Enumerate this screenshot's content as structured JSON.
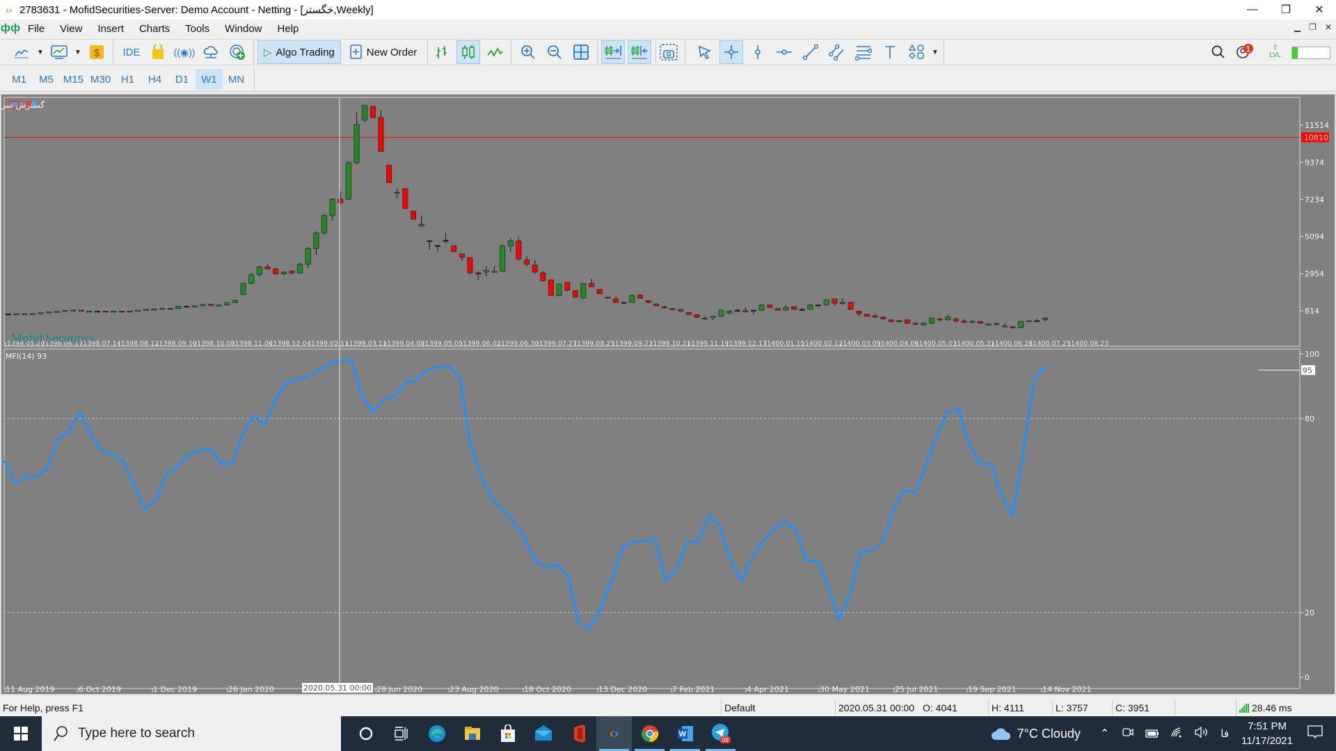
{
  "window": {
    "title": "2783631 - MofidSecurities-Server: Demo Account - Netting - [خگستر,Weekly]",
    "controls": [
      "minimize",
      "restore",
      "close"
    ]
  },
  "menu": {
    "items": [
      "File",
      "View",
      "Insert",
      "Charts",
      "Tools",
      "Window",
      "Help"
    ]
  },
  "toolbar": {
    "ide_label": "IDE",
    "algo_trading_label": "Algo Trading",
    "new_order_label": "New Order",
    "notification_count": "1",
    "level_label": "LVL"
  },
  "timeframes": {
    "items": [
      "M1",
      "M5",
      "M15",
      "M30",
      "H1",
      "H4",
      "D1",
      "W1",
      "MN"
    ],
    "active": "W1"
  },
  "chart": {
    "symbol_header": "گسترش سرمایه گذاری ایران خودرو  2430 2609 2368 2609  :Weekly ,خگستر",
    "watermark": "Mofid Securities",
    "indicator_label": "MFI(14) 93",
    "current_price_label": "10810",
    "mfi_current_label": "95",
    "crosshair_time_label": "2020.05.31 00:00"
  },
  "chart_data": [
    {
      "type": "candlestick",
      "title": "خگستر, Weekly",
      "ylim": [
        0,
        12500
      ],
      "yticks": [
        814,
        2954,
        5094,
        7234,
        9374,
        11514
      ],
      "current_price": 10810,
      "candles": [
        [
          640,
          660,
          620,
          640
        ],
        [
          640,
          660,
          620,
          645
        ],
        [
          645,
          660,
          625,
          650
        ],
        [
          650,
          670,
          630,
          655
        ],
        [
          655,
          720,
          640,
          700
        ],
        [
          700,
          760,
          690,
          750
        ],
        [
          750,
          800,
          720,
          780
        ],
        [
          780,
          860,
          760,
          830
        ],
        [
          830,
          900,
          790,
          860
        ],
        [
          860,
          870,
          770,
          790
        ],
        [
          790,
          820,
          760,
          800
        ],
        [
          800,
          820,
          780,
          800
        ],
        [
          800,
          820,
          770,
          790
        ],
        [
          790,
          810,
          770,
          800
        ],
        [
          800,
          810,
          760,
          780
        ],
        [
          780,
          820,
          770,
          800
        ],
        [
          800,
          870,
          780,
          850
        ],
        [
          850,
          920,
          830,
          900
        ],
        [
          900,
          950,
          880,
          920
        ],
        [
          920,
          980,
          900,
          960
        ],
        [
          960,
          970,
          900,
          950
        ],
        [
          950,
          1100,
          940,
          1080
        ],
        [
          1080,
          1120,
          1030,
          1080
        ],
        [
          1080,
          1130,
          1050,
          1100
        ],
        [
          1100,
          1200,
          1080,
          1190
        ],
        [
          1190,
          1200,
          1100,
          1130
        ],
        [
          1130,
          1170,
          1110,
          1150
        ],
        [
          1150,
          1300,
          1130,
          1290
        ],
        [
          1290,
          1450,
          1270,
          1420
        ],
        [
          1750,
          2450,
          1730,
          2400
        ],
        [
          2400,
          3000,
          2350,
          2900
        ],
        [
          2900,
          3400,
          2800,
          3350
        ],
        [
          3350,
          3500,
          3200,
          3230
        ],
        [
          3230,
          3300,
          2900,
          2950
        ],
        [
          2950,
          3100,
          2850,
          3050
        ],
        [
          3100,
          3150,
          2900,
          3000
        ],
        [
          3000,
          3600,
          2950,
          3500
        ],
        [
          3500,
          4500,
          3300,
          4400
        ],
        [
          4400,
          5400,
          4050,
          5300
        ],
        [
          5300,
          6400,
          5200,
          6300
        ],
        [
          6300,
          7300,
          6000,
          7250
        ],
        [
          7250,
          7700,
          6950,
          7050
        ],
        [
          7250,
          9450,
          7200,
          9350
        ],
        [
          9350,
          12300,
          9250,
          11550
        ],
        [
          11800,
          12650,
          11700,
          12650
        ],
        [
          12600,
          12450,
          11950,
          11950
        ],
        [
          11950,
          12380,
          10000,
          10000
        ],
        [
          9200,
          9200,
          8200,
          8200
        ],
        [
          7600,
          7880,
          7280,
          7650
        ],
        [
          7850,
          7850,
          6700,
          6700
        ],
        [
          6560,
          6560,
          6100,
          6100
        ],
        [
          5700,
          6300,
          5700,
          5800
        ],
        [
          4860,
          4860,
          4340,
          4860
        ],
        [
          4580,
          4580,
          4220,
          4580
        ],
        [
          4880,
          5300,
          4700,
          4880
        ],
        [
          4560,
          4560,
          4200,
          4230
        ],
        [
          4100,
          4100,
          3700,
          3900
        ],
        [
          3880,
          3880,
          2900,
          3000
        ],
        [
          3000,
          3100,
          2570,
          3000
        ],
        [
          3050,
          3400,
          2800,
          3150
        ],
        [
          3080,
          3400,
          3000,
          3100
        ],
        [
          3100,
          4600,
          3050,
          4560
        ],
        [
          4550,
          5000,
          4200,
          4850
        ],
        [
          4840,
          5090,
          3700,
          3800
        ],
        [
          3750,
          3950,
          3360,
          3490
        ],
        [
          3450,
          3750,
          2950,
          3050
        ],
        [
          3000,
          3100,
          2500,
          2550
        ],
        [
          2600,
          2600,
          1700,
          1700
        ],
        [
          1700,
          2400,
          1650,
          2350
        ],
        [
          2450,
          2450,
          1950,
          2000
        ],
        [
          1980,
          1980,
          1550,
          1600
        ],
        [
          1550,
          2400,
          1500,
          2380
        ],
        [
          2400,
          2650,
          2200,
          2200
        ],
        [
          2050,
          2050,
          1800,
          1800
        ],
        [
          1600,
          1600,
          1500,
          1550
        ],
        [
          1500,
          1650,
          1250,
          1300
        ],
        [
          1300,
          1350,
          1200,
          1300
        ],
        [
          1300,
          1750,
          1280,
          1700
        ],
        [
          1720,
          1800,
          1500,
          1550
        ],
        [
          1400,
          1400,
          1250,
          1300
        ],
        [
          1200,
          1250,
          1100,
          1100
        ],
        [
          1050,
          1100,
          950,
          1000
        ],
        [
          950,
          950,
          850,
          900
        ],
        [
          880,
          950,
          750,
          800
        ],
        [
          720,
          720,
          550,
          600
        ],
        [
          590,
          600,
          400,
          450
        ],
        [
          350,
          500,
          300,
          400
        ],
        [
          420,
          500,
          250,
          500
        ],
        [
          500,
          850,
          450,
          850
        ],
        [
          700,
          870,
          600,
          800
        ],
        [
          850,
          950,
          750,
          850
        ],
        [
          820,
          1000,
          780,
          800
        ],
        [
          850,
          850,
          600,
          850
        ],
        [
          850,
          1200,
          820,
          1150
        ],
        [
          1150,
          1200,
          1000,
          1000
        ],
        [
          950,
          950,
          850,
          850
        ],
        [
          850,
          1150,
          800,
          1000
        ],
        [
          1050,
          1050,
          880,
          900
        ],
        [
          900,
          1000,
          800,
          900
        ],
        [
          900,
          1200,
          880,
          1150
        ],
        [
          1150,
          1200,
          1100,
          1150
        ],
        [
          1150,
          1450,
          1100,
          1450
        ],
        [
          1500,
          1500,
          1100,
          1250
        ],
        [
          1250,
          1550,
          1150,
          1300
        ],
        [
          1300,
          1300,
          900,
          900
        ],
        [
          800,
          800,
          500,
          650
        ],
        [
          620,
          620,
          480,
          500
        ],
        [
          520,
          620,
          400,
          500
        ],
        [
          450,
          500,
          300,
          350
        ],
        [
          300,
          300,
          150,
          200
        ],
        [
          200,
          300,
          150,
          250
        ],
        [
          300,
          300,
          50,
          100
        ],
        [
          100,
          150,
          0,
          50
        ],
        [
          0,
          150,
          0,
          100
        ],
        [
          100,
          420,
          50,
          400
        ],
        [
          350,
          420,
          200,
          300
        ],
        [
          300,
          600,
          250,
          450
        ],
        [
          350,
          450,
          150,
          220
        ],
        [
          220,
          350,
          100,
          150
        ],
        [
          150,
          300,
          100,
          200
        ],
        [
          200,
          250,
          50,
          100
        ],
        [
          0,
          100,
          0,
          50
        ],
        [
          50,
          150,
          0,
          80
        ],
        [
          -100,
          100,
          -150,
          -50
        ],
        [
          -100,
          -50,
          -200,
          -150
        ],
        [
          -150,
          200,
          -200,
          200
        ],
        [
          200,
          250,
          150,
          250
        ],
        [
          250,
          350,
          150,
          250
        ],
        [
          300,
          450,
          200,
          400
        ]
      ],
      "x_labels_top": [
        "1398.05.20",
        "1398.06.17",
        "1398.07.14",
        "1398.08.12",
        "1398.09.10",
        "1398.10.08",
        "1398.11.06",
        "1398.12.04",
        "1399.02.11",
        "1399.03.11",
        "1399.04.08",
        "1399.05.05",
        "1399.06.02",
        "1399.06.30",
        "1399.07.27",
        "1399.08.25",
        "1399.09.23",
        "1399.10.21",
        "1399.11.19",
        "1399.12.17",
        "1400.01.15",
        "1400.02.12",
        "1400.03.09",
        "1400.04.06",
        "1400.05.03",
        "1400.05.31",
        "1400.06.28",
        "1400.07.25",
        "1400.08.23"
      ]
    },
    {
      "type": "line",
      "title": "MFI(14) 93",
      "ylim": [
        0,
        100
      ],
      "yticks": [
        0,
        20,
        80,
        100
      ],
      "levels": [
        20,
        80
      ],
      "current_value": 95,
      "values": [
        67,
        60,
        62,
        62,
        65,
        74,
        76,
        82,
        75,
        70,
        69,
        67,
        59,
        52,
        55,
        63,
        65,
        69,
        70,
        71,
        66,
        66,
        75,
        81,
        78,
        86,
        91,
        92,
        93,
        95,
        97,
        98,
        98,
        87,
        82,
        86,
        87,
        91,
        92,
        95,
        96,
        96,
        93,
        72,
        62,
        55,
        52,
        48,
        43,
        36,
        34,
        35,
        31,
        17,
        15,
        21,
        30,
        40,
        42,
        42,
        43,
        30,
        33,
        42,
        42,
        50,
        47,
        36,
        30,
        37,
        42,
        46,
        48,
        46,
        36,
        36,
        28,
        18,
        26,
        39,
        39,
        42,
        52,
        58,
        57,
        65,
        75,
        82,
        83,
        72,
        66,
        66,
        56,
        50,
        70,
        92,
        96
      ],
      "x_labels": [
        "11 Aug 2019",
        "6 Oct 2019",
        "1 Dec 2019",
        "26 Jan 2020",
        "2020.05.31 00:00",
        "28 Jun 2020",
        "23 Aug 2020",
        "18 Oct 2020",
        "13 Dec 2020",
        "7 Feb 2021",
        "4 Apr 2021",
        "30 May 2021",
        "25 Jul 2021",
        "19 Sep 2021",
        "14 Nov 2021"
      ]
    }
  ],
  "colors": {
    "background": "#808080",
    "bull": "#228b22",
    "bear": "#ff0000",
    "mfi_line": "#1e90ff",
    "price_line": "#ff0000",
    "text": "#ffffff"
  },
  "statusbar": {
    "help": "For Help, press F1",
    "profile": "Default",
    "time": "2020.05.31 00:00",
    "open": "O: 4041",
    "high": "H: 4111",
    "low": "L: 3757",
    "close": "C: 3951",
    "ping": "28.46 ms"
  },
  "taskbar": {
    "search_placeholder": "Type here to search",
    "weather": "7°C  Cloudy",
    "lang": "فا",
    "time": "7:51 PM",
    "date": "11/17/2021",
    "telegram_badge": "09"
  }
}
